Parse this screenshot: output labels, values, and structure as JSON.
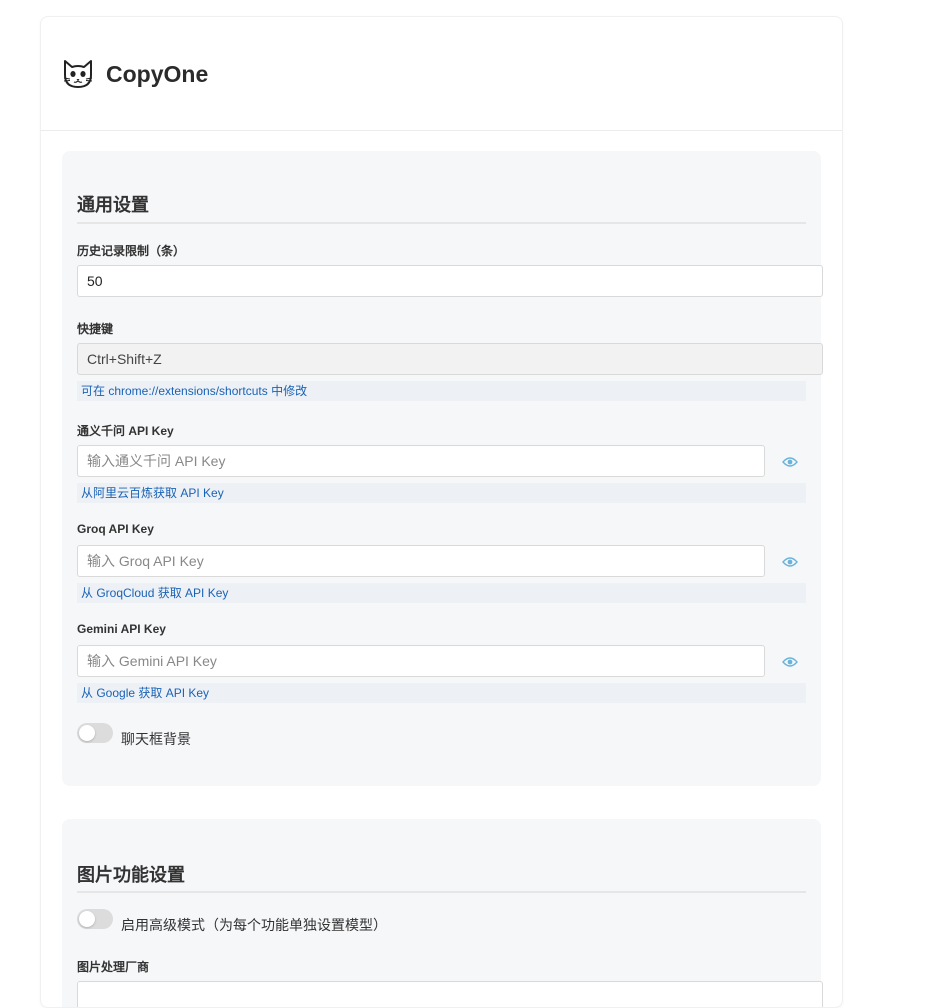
{
  "app": {
    "title": "CopyOne",
    "logo_icon": "cat-face-icon"
  },
  "general_settings": {
    "title": "通用设置",
    "history_limit": {
      "label": "历史记录限制（条）",
      "value": "50"
    },
    "shortcut": {
      "label": "快捷键",
      "value": "Ctrl+Shift+Z",
      "hint": "可在 chrome://extensions/shortcuts 中修改"
    },
    "qwen_key": {
      "label": "通义千问 API Key",
      "placeholder": "输入通义千问 API Key",
      "hint": "从阿里云百炼获取 API Key",
      "toggle_icon": "eye-icon"
    },
    "groq_key": {
      "label": "Groq API Key",
      "placeholder": "输入 Groq API Key",
      "hint": "从 GroqCloud 获取 API Key",
      "toggle_icon": "eye-icon"
    },
    "gemini_key": {
      "label": "Gemini API Key",
      "placeholder": "输入 Gemini API Key",
      "hint": "从 Google 获取 API Key",
      "toggle_icon": "eye-icon"
    },
    "chat_background": {
      "label": "聊天框背景",
      "enabled": false
    }
  },
  "image_settings": {
    "title": "图片功能设置",
    "advanced_mode": {
      "label": "启用高级模式（为每个功能单独设置模型）",
      "enabled": false
    },
    "vendor": {
      "label": "图片处理厂商"
    }
  },
  "colors": {
    "accent_link": "#1a62b5",
    "eye_icon": "#6ab4dc",
    "section_bg": "#f6f7f9",
    "hint_bg": "#edf1f6"
  }
}
